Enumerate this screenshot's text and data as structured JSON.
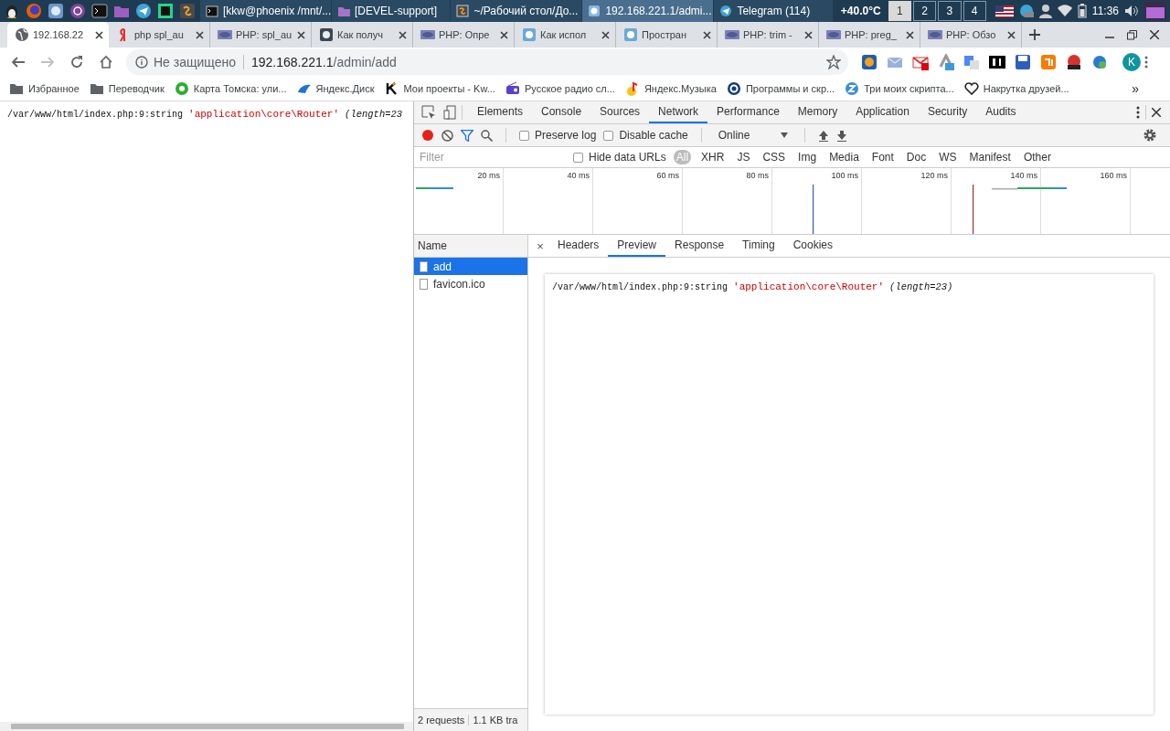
{
  "taskbar": {
    "tasks": [
      {
        "title": "[kkw@phoenix /mnt/...",
        "selected": false
      },
      {
        "title": "[DEVEL-support]",
        "selected": false
      },
      {
        "title": "~/Рабочий стол/До...",
        "selected": false
      },
      {
        "title": "192.168.221.1/admi...",
        "selected": true
      },
      {
        "title": "Telegram (114)",
        "selected": false
      }
    ],
    "temperature": "+40.0°C",
    "workspaces": [
      {
        "label": "1",
        "selected": true
      },
      {
        "label": "2",
        "selected": false
      },
      {
        "label": "3",
        "selected": false
      },
      {
        "label": "4",
        "selected": false
      }
    ],
    "clock": "11:36"
  },
  "browser": {
    "tabs": [
      {
        "title": "192.168.22",
        "selected": true
      },
      {
        "title": "php spl_au",
        "selected": false
      },
      {
        "title": "PHP: spl_au",
        "selected": false
      },
      {
        "title": "Как получ",
        "selected": false
      },
      {
        "title": "PHP: Опре",
        "selected": false
      },
      {
        "title": "Как испол",
        "selected": false
      },
      {
        "title": "Простран",
        "selected": false
      },
      {
        "title": "PHP: trim -",
        "selected": false
      },
      {
        "title": "PHP: preg_",
        "selected": false
      },
      {
        "title": "PHP: Обзо",
        "selected": false
      }
    ],
    "address": {
      "security": "Не защищено",
      "host": "192.168.221.1",
      "path": "/admin/add"
    },
    "avatar": "K",
    "bookmarks": [
      "Избранное",
      "Переводчик",
      "Карта Томска: ули...",
      "Яндекс.Диск",
      "Мои проекты - Kw...",
      "Русское радио сл...",
      "Яндекс.Музыка",
      "Программы и скр...",
      "Три моих скрипта...",
      "Накрутка  друзей..."
    ],
    "more": "»"
  },
  "page": {
    "location": "/var/www/html/index.php:9:string",
    "value": "'application\\core\\Router'",
    "length": "(length=23"
  },
  "devtools": {
    "tabs": [
      {
        "label": "Elements",
        "selected": false
      },
      {
        "label": "Console",
        "selected": false
      },
      {
        "label": "Sources",
        "selected": false
      },
      {
        "label": "Network",
        "selected": true
      },
      {
        "label": "Performance",
        "selected": false
      },
      {
        "label": "Memory",
        "selected": false
      },
      {
        "label": "Application",
        "selected": false
      },
      {
        "label": "Security",
        "selected": false
      },
      {
        "label": "Audits",
        "selected": false
      }
    ],
    "recording": true,
    "options": [
      {
        "label": "Preserve log",
        "checked": false
      },
      {
        "label": "Disable cache",
        "checked": false
      }
    ],
    "throttling": "Online",
    "filter": {
      "placeholder": "Filter",
      "hide_data_urls": {
        "label": "Hide data URLs",
        "checked": false
      },
      "types": [
        {
          "label": "All",
          "selected": true
        },
        {
          "label": "XHR",
          "selected": false
        },
        {
          "label": "JS",
          "selected": false
        },
        {
          "label": "CSS",
          "selected": false
        },
        {
          "label": "Img",
          "selected": false
        },
        {
          "label": "Media",
          "selected": false
        },
        {
          "label": "Font",
          "selected": false
        },
        {
          "label": "Doc",
          "selected": false
        },
        {
          "label": "WS",
          "selected": false
        },
        {
          "label": "Manifest",
          "selected": false
        },
        {
          "label": "Other",
          "selected": false
        }
      ]
    },
    "timeline_ticks": [
      "20 ms",
      "40 ms",
      "60 ms",
      "80 ms",
      "100 ms",
      "120 ms",
      "140 ms",
      "160 ms"
    ],
    "name_header": "Name",
    "requests": [
      {
        "name": "add",
        "selected": true
      },
      {
        "name": "favicon.ico",
        "selected": false
      }
    ],
    "detail_close": "×",
    "detail_tabs": [
      {
        "label": "Headers",
        "selected": false
      },
      {
        "label": "Preview",
        "selected": true
      },
      {
        "label": "Response",
        "selected": false
      },
      {
        "label": "Timing",
        "selected": false
      },
      {
        "label": "Cookies",
        "selected": false
      }
    ],
    "preview": {
      "location": "/var/www/html/index.php:9:string",
      "value": "'application\\core\\Router'",
      "length": "(length=23)"
    },
    "status": [
      "2 requests",
      "1.1 KB tra"
    ]
  }
}
